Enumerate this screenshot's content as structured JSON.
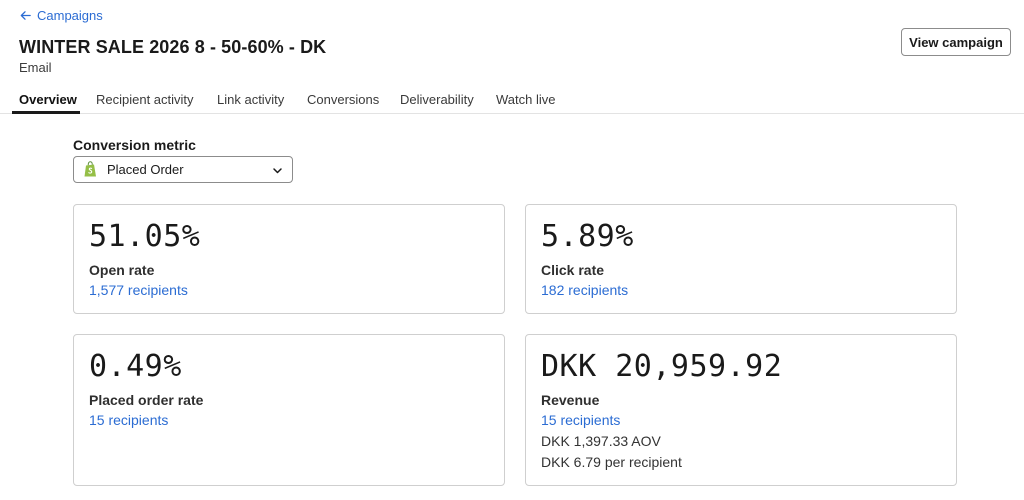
{
  "nav": {
    "back_label": "Campaigns"
  },
  "header": {
    "title": "WINTER SALE 2026 8 - 50-60% - DK",
    "subtitle": "Email",
    "view_campaign_label": "View campaign"
  },
  "tabs": [
    {
      "label": "Overview",
      "active": true
    },
    {
      "label": "Recipient activity"
    },
    {
      "label": "Link activity"
    },
    {
      "label": "Conversions"
    },
    {
      "label": "Deliverability"
    },
    {
      "label": "Watch live"
    }
  ],
  "conversion_metric": {
    "label": "Conversion metric",
    "selected": "Placed Order",
    "icon": "shopify-icon"
  },
  "cards": {
    "open_rate": {
      "value": "51.05%",
      "label": "Open rate",
      "recipients": "1,577 recipients"
    },
    "click_rate": {
      "value": "5.89%",
      "label": "Click rate",
      "recipients": "182 recipients"
    },
    "placed_order_rate": {
      "value": "0.49%",
      "label": "Placed order rate",
      "recipients": "15 recipients"
    },
    "revenue": {
      "value": "DKK 20,959.92",
      "label": "Revenue",
      "recipients": "15 recipients",
      "aov": "DKK 1,397.33 AOV",
      "per_recipient": "DKK 6.79 per recipient"
    }
  },
  "colors": {
    "link": "#2b6cd3",
    "shopify_green": "#95bf47"
  }
}
